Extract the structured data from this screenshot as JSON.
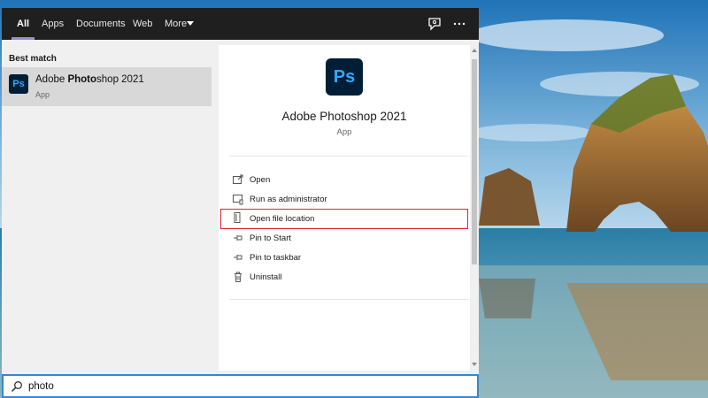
{
  "tabs": [
    {
      "label": "All"
    },
    {
      "label": "Apps"
    },
    {
      "label": "Documents"
    },
    {
      "label": "Web"
    },
    {
      "label": "More"
    }
  ],
  "topbar_icons": [
    "feedback-icon",
    "more-options-icon"
  ],
  "results": {
    "heading": "Best match",
    "item": {
      "icon_text": "Ps",
      "name_prefix": "Adobe ",
      "name_match": "Photo",
      "name_suffix": "shop 2021",
      "type": "App"
    }
  },
  "detail": {
    "icon_text": "Ps",
    "title": "Adobe Photoshop 2021",
    "subtitle": "App",
    "actions": [
      {
        "label": "Open",
        "icon": "open-icon"
      },
      {
        "label": "Run as administrator",
        "icon": "run-as-admin-icon"
      },
      {
        "label": "Open file location",
        "icon": "folder-icon",
        "highlighted": true
      },
      {
        "label": "Pin to Start",
        "icon": "pin-icon"
      },
      {
        "label": "Pin to taskbar",
        "icon": "pin-icon"
      },
      {
        "label": "Uninstall",
        "icon": "trash-icon"
      }
    ]
  },
  "search": {
    "value": "photo"
  },
  "colors": {
    "accent": "#9b8ad6",
    "highlight_border": "#e0242d",
    "photoshop_bg": "#001e36",
    "photoshop_fg": "#31a8ff"
  }
}
